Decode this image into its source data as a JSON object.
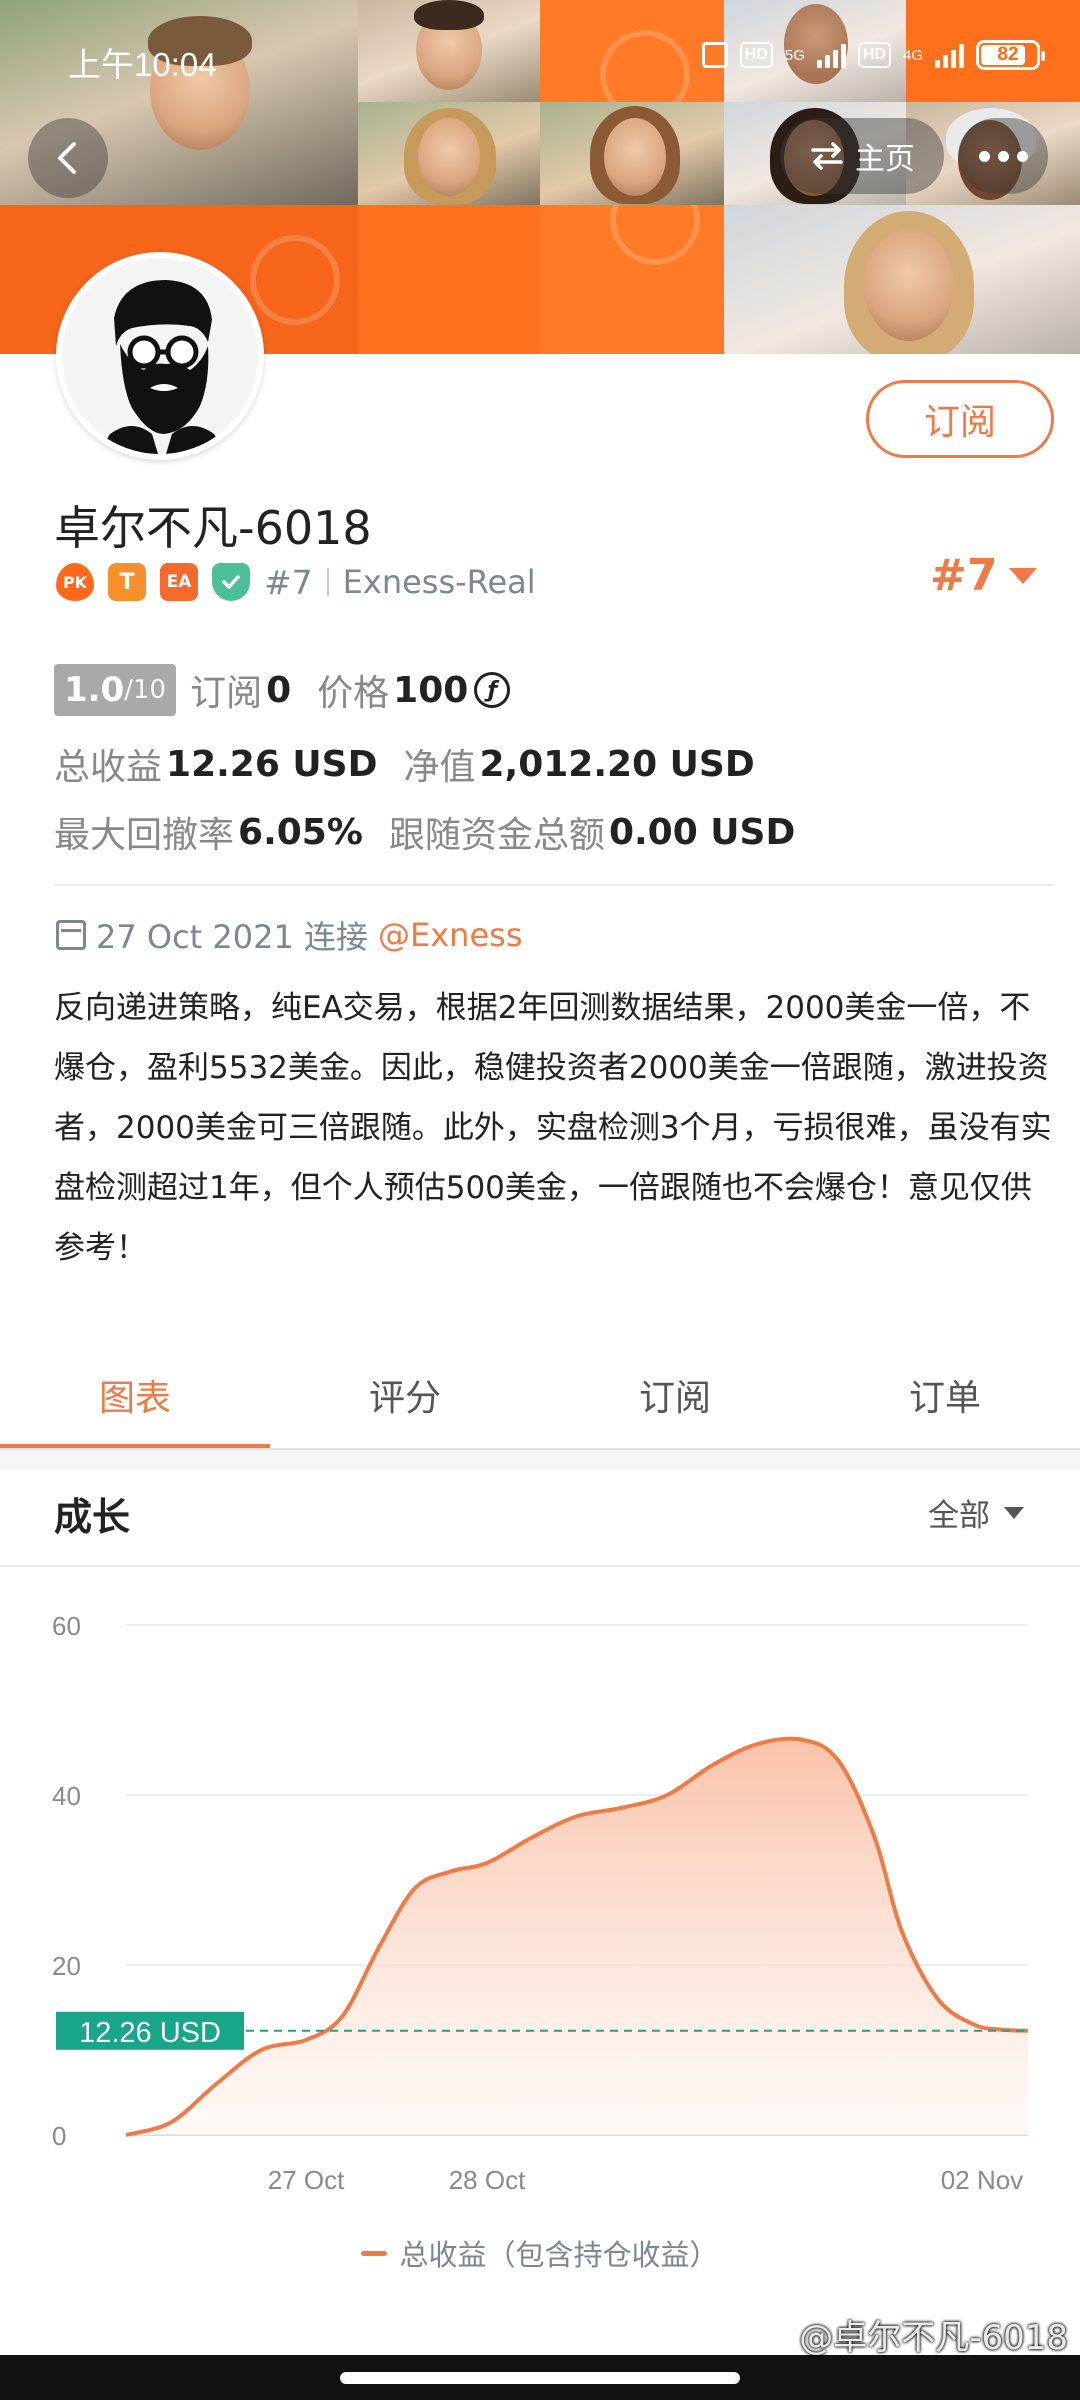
{
  "status_bar": {
    "time": "上午10:04",
    "network_1": "5G",
    "network_2": "4G",
    "hd": "HD",
    "battery": "82"
  },
  "nav": {
    "home_label": "主页"
  },
  "profile": {
    "name": "卓尔不凡-6018",
    "badges": [
      "PK",
      "T",
      "EA"
    ],
    "rank_small": "#7",
    "broker": "Exness-Real",
    "rank_big": "#7",
    "subscribe_label": "订阅"
  },
  "stats": {
    "score": "1.0",
    "score_max": "/10",
    "subscribe_label": "订阅",
    "subscribe_count": "0",
    "price_label": "价格",
    "price_value": "100",
    "coin_symbol": "ƒ",
    "total_profit_label": "总收益",
    "total_profit_value": "12.26 USD",
    "equity_label": "净值",
    "equity_value": "2,012.20 USD",
    "max_drawdown_label": "最大回撤率",
    "max_drawdown_value": "6.05%",
    "follow_funds_label": "跟随资金总额",
    "follow_funds_value": "0.00 USD"
  },
  "connection": {
    "date": "27 Oct 2021 连接",
    "broker_link": "@Exness"
  },
  "description": "反向递进策略，纯EA交易，根据2年回测数据结果，2000美金一倍，不爆仓，盈利5532美金。因此，稳健投资者2000美金一倍跟随，激进投资者，2000美金可三倍跟随。此外，实盘检测3个月，亏损很难，虽没有实盘检测超过1年，但个人预估500美金，一倍跟随也不会爆仓！意见仅供参考！",
  "tabs": [
    {
      "label": "图表",
      "active": true
    },
    {
      "label": "评分",
      "active": false
    },
    {
      "label": "订阅",
      "active": false
    },
    {
      "label": "订单",
      "active": false
    }
  ],
  "growth": {
    "title": "成长",
    "range_label": "全部"
  },
  "chart_data": {
    "type": "area",
    "ylim": [
      0,
      60
    ],
    "yticks": [
      0,
      20,
      40,
      60
    ],
    "xtick_labels": [
      "27 Oct",
      "28 Oct",
      "02 Nov"
    ],
    "x": [
      0,
      0.05,
      0.1,
      0.15,
      0.2,
      0.24,
      0.28,
      0.32,
      0.36,
      0.4,
      0.45,
      0.5,
      0.55,
      0.6,
      0.65,
      0.7,
      0.75,
      0.79,
      0.83,
      0.86,
      0.9,
      0.94,
      0.97,
      1.0
    ],
    "values": [
      0,
      1.5,
      6,
      10,
      11.2,
      14,
      22,
      29,
      31,
      32,
      35,
      37.5,
      38.5,
      40,
      43.5,
      46,
      46.5,
      44,
      35,
      24,
      16,
      13,
      12.4,
      12.26
    ],
    "current_value_label": "12.26 USD",
    "current_value": 12.26,
    "series_name": "总收益（包含持仓收益）",
    "grid": true,
    "colors": {
      "line": "#f07a45",
      "fill_top": "#f8b89a",
      "fill_bottom": "#fff4ee",
      "marker": "#17a689"
    }
  },
  "watermark": "@卓尔不凡-6018"
}
